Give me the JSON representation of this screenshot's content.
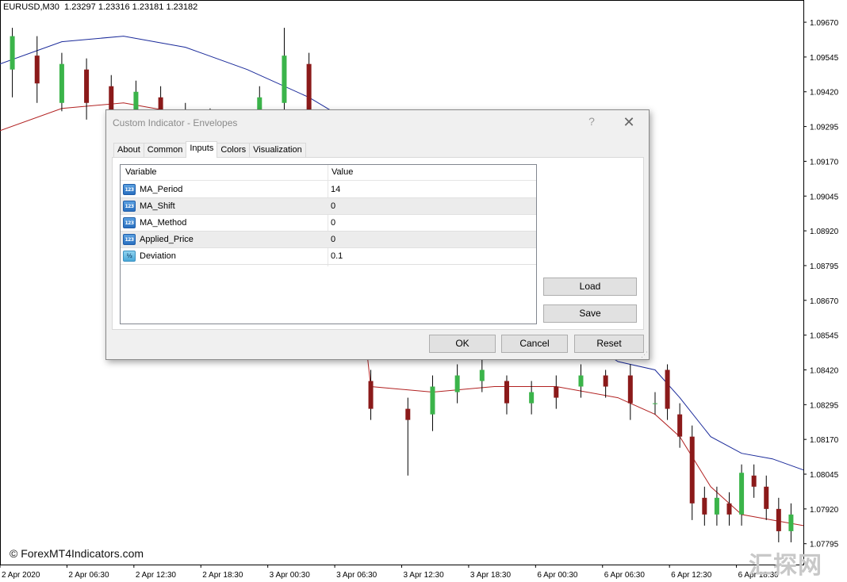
{
  "chart": {
    "header": "EURUSD,M30  1.23297 1.23316 1.23181 1.23182",
    "watermark": "© ForexMT4Indicators.com",
    "brand_mark": "汇探网",
    "colors": {
      "bull_candle": "#3bb44a",
      "bear_candle": "#8b1a1a",
      "upper_envelope": "#1a2a9a",
      "lower_envelope": "#b22222"
    }
  },
  "chart_data": {
    "type": "candlestick",
    "symbol": "EURUSD",
    "timeframe": "M30",
    "y_ticks": [
      "1.09670",
      "1.09545",
      "1.09420",
      "1.09295",
      "1.09170",
      "1.09045",
      "1.08920",
      "1.08795",
      "1.08670",
      "1.08545",
      "1.08420",
      "1.08295",
      "1.08170",
      "1.08045",
      "1.07920",
      "1.07795"
    ],
    "x_ticks": [
      "2 Apr 2020",
      "2 Apr 06:30",
      "2 Apr 12:30",
      "2 Apr 18:30",
      "3 Apr 00:30",
      "3 Apr 06:30",
      "3 Apr 12:30",
      "3 Apr 18:30",
      "6 Apr 00:30",
      "6 Apr 06:30",
      "6 Apr 12:30",
      "6 Apr 18:30"
    ],
    "ylim": [
      1.0772,
      1.0975
    ],
    "x_range": [
      0,
      130
    ],
    "candles": [
      [
        2,
        1.095,
        1.0962,
        1.094,
        1.0965
      ],
      [
        6,
        1.0955,
        1.0945,
        1.0938,
        1.0962
      ],
      [
        10,
        1.0938,
        1.0952,
        1.0935,
        1.0956
      ],
      [
        14,
        1.095,
        1.0938,
        1.0932,
        1.0954
      ],
      [
        18,
        1.0944,
        1.093,
        1.0924,
        1.0948
      ],
      [
        22,
        1.093,
        1.0942,
        1.0926,
        1.0946
      ],
      [
        26,
        1.094,
        1.0925,
        1.092,
        1.0944
      ],
      [
        30,
        1.0924,
        1.0935,
        1.0918,
        1.0938
      ],
      [
        34,
        1.0932,
        1.0918,
        1.0912,
        1.0936
      ],
      [
        38,
        1.092,
        1.093,
        1.0915,
        1.0934
      ],
      [
        42,
        1.0928,
        1.094,
        1.0922,
        1.0944
      ],
      [
        46,
        1.0938,
        1.0955,
        1.0934,
        1.0965
      ],
      [
        50,
        1.0952,
        1.0918,
        1.0914,
        1.0956
      ],
      [
        54,
        1.092,
        1.0924,
        1.0912,
        1.0928
      ],
      [
        58,
        1.0922,
        1.0916,
        1.091,
        1.0926
      ],
      [
        60,
        1.0838,
        1.0828,
        1.0824,
        1.0842
      ],
      [
        66,
        1.0828,
        1.0824,
        1.0804,
        1.0832
      ],
      [
        70,
        1.0826,
        1.0836,
        1.082,
        1.084
      ],
      [
        74,
        1.0834,
        1.084,
        1.083,
        1.0844
      ],
      [
        78,
        1.0838,
        1.0842,
        1.0834,
        1.0846
      ],
      [
        82,
        1.0838,
        1.083,
        1.0826,
        1.084
      ],
      [
        86,
        1.083,
        1.0834,
        1.0826,
        1.0838
      ],
      [
        90,
        1.0836,
        1.0832,
        1.0828,
        1.084
      ],
      [
        94,
        1.0836,
        1.084,
        1.0832,
        1.0844
      ],
      [
        98,
        1.084,
        1.0836,
        1.0832,
        1.0842
      ],
      [
        102,
        1.084,
        1.083,
        1.0824,
        1.0844
      ],
      [
        106,
        1.083,
        1.083,
        1.0826,
        1.0834
      ],
      [
        108,
        1.0842,
        1.0828,
        1.0824,
        1.0844
      ],
      [
        110,
        1.0826,
        1.0818,
        1.0814,
        1.083
      ],
      [
        112,
        1.0818,
        1.0794,
        1.0788,
        1.0822
      ],
      [
        114,
        1.0796,
        1.079,
        1.0786,
        1.08
      ],
      [
        116,
        1.079,
        1.0796,
        1.0786,
        1.08
      ],
      [
        118,
        1.0794,
        1.079,
        1.0786,
        1.0798
      ],
      [
        120,
        1.079,
        1.0805,
        1.0786,
        1.0808
      ],
      [
        122,
        1.0804,
        1.08,
        1.0796,
        1.0808
      ],
      [
        124,
        1.08,
        1.0792,
        1.0788,
        1.0804
      ],
      [
        126,
        1.0792,
        1.0784,
        1.078,
        1.0796
      ],
      [
        128,
        1.0784,
        1.079,
        1.078,
        1.0794
      ]
    ],
    "upper_envelope": [
      [
        0,
        1.0952
      ],
      [
        10,
        1.096
      ],
      [
        20,
        1.0962
      ],
      [
        30,
        1.0958
      ],
      [
        40,
        1.095
      ],
      [
        50,
        1.094
      ],
      [
        56,
        1.0932
      ],
      [
        60,
        1.092
      ],
      [
        70,
        1.09
      ],
      [
        80,
        1.088
      ],
      [
        90,
        1.086
      ],
      [
        100,
        1.0845
      ],
      [
        106,
        1.0842
      ],
      [
        110,
        1.0832
      ],
      [
        115,
        1.0818
      ],
      [
        120,
        1.0812
      ],
      [
        125,
        1.081
      ],
      [
        130,
        1.0806
      ]
    ],
    "lower_envelope": [
      [
        0,
        1.0928
      ],
      [
        10,
        1.0936
      ],
      [
        20,
        1.0938
      ],
      [
        30,
        1.0934
      ],
      [
        40,
        1.0928
      ],
      [
        50,
        1.092
      ],
      [
        56,
        1.0916
      ],
      [
        60,
        1.0836
      ],
      [
        70,
        1.0834
      ],
      [
        80,
        1.0836
      ],
      [
        90,
        1.0836
      ],
      [
        100,
        1.0832
      ],
      [
        106,
        1.0826
      ],
      [
        110,
        1.0818
      ],
      [
        115,
        1.08
      ],
      [
        120,
        1.079
      ],
      [
        125,
        1.0788
      ],
      [
        130,
        1.0786
      ]
    ]
  },
  "dialog": {
    "title": "Custom Indicator - Envelopes",
    "help_label": "?",
    "close_label": "✕",
    "tabs": [
      {
        "label": "About"
      },
      {
        "label": "Common"
      },
      {
        "label": "Inputs"
      },
      {
        "label": "Colors"
      },
      {
        "label": "Visualization"
      }
    ],
    "active_tab": "Inputs",
    "table": {
      "col_variable": "Variable",
      "col_value": "Value",
      "rows": [
        {
          "icon": "123",
          "type": "int",
          "name": "MA_Period",
          "value": "14"
        },
        {
          "icon": "123",
          "type": "int",
          "name": "MA_Shift",
          "value": "0"
        },
        {
          "icon": "123",
          "type": "int",
          "name": "MA_Method",
          "value": "0"
        },
        {
          "icon": "123",
          "type": "int",
          "name": "Applied_Price",
          "value": "0"
        },
        {
          "icon": "½",
          "type": "double",
          "name": "Deviation",
          "value": "0.1"
        }
      ]
    },
    "buttons": {
      "load": "Load",
      "save": "Save",
      "ok": "OK",
      "cancel": "Cancel",
      "reset": "Reset"
    }
  }
}
